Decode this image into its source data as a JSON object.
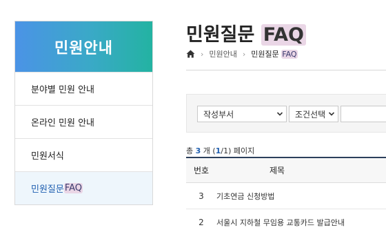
{
  "sidebar": {
    "title": "민원안내",
    "items": [
      {
        "label": "분야별 민원 안내"
      },
      {
        "label": "온라인 민원 안내"
      },
      {
        "label": "민원서식"
      },
      {
        "label_main": "민원질문 ",
        "label_hl": "FAQ"
      }
    ]
  },
  "main": {
    "title_main": "민원질문 ",
    "title_hl": "FAQ",
    "breadcrumb": {
      "home_icon": "home-icon",
      "items": [
        "민원안내"
      ],
      "current_main": "민원질문 ",
      "current_hl": "FAQ"
    },
    "search": {
      "dept_select": "작성부서",
      "cond_select": "조건선택",
      "keyword_value": ""
    },
    "count": {
      "prefix": "총 ",
      "total": "3",
      "unit": " 개 (",
      "page": "1",
      "slash": "/",
      "pages": "1",
      "suffix": ") 페이지"
    },
    "table": {
      "headers": {
        "no": "번호",
        "title": "제목"
      },
      "rows": [
        {
          "no": "3",
          "title": "기초연금 신청방법"
        },
        {
          "no": "2",
          "title": "서울시 지하철 무임용 교통카드 발급안내"
        }
      ]
    }
  },
  "colors": {
    "accent": "#1f5fb0",
    "header_gradient_start": "#4b93e6",
    "header_gradient_end": "#23b3a2",
    "highlight": "#ead6e6"
  }
}
